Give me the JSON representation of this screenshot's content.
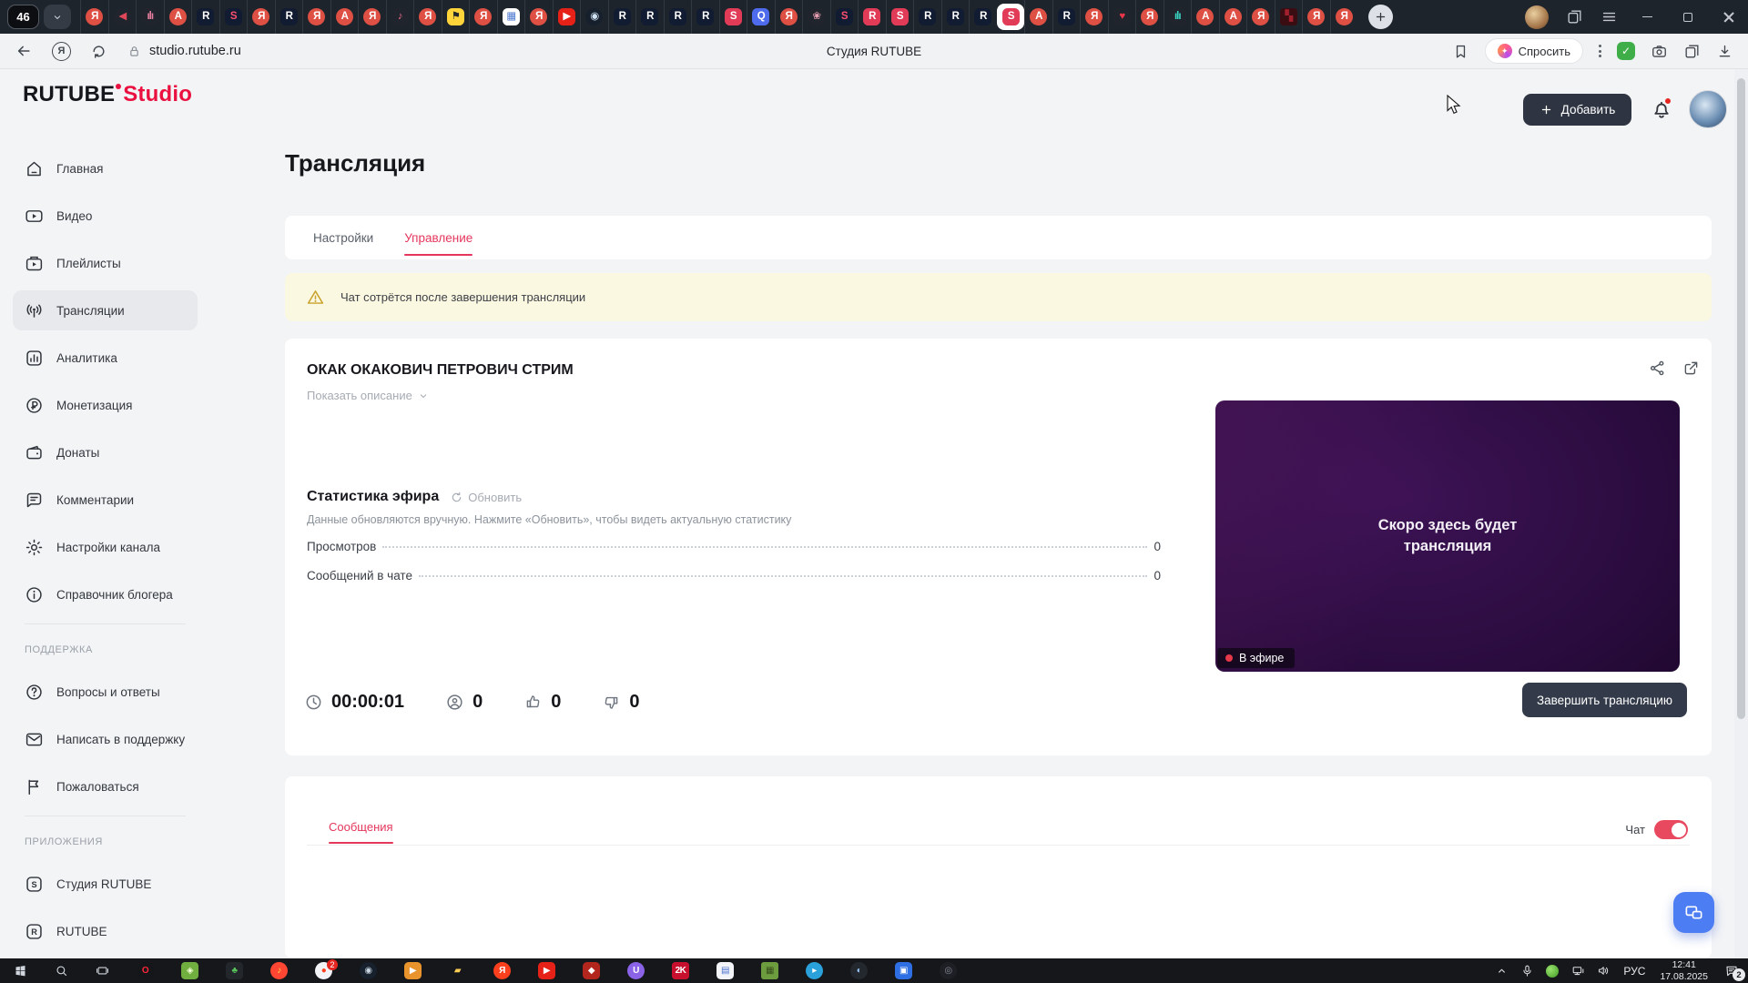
{
  "theme": {
    "accent_red": "#e5365c",
    "dark_button": "#2e3441",
    "warning_bg": "#fbf8e2",
    "live_red": "#e5394a",
    "fab_blue": "#4d7df2",
    "chrome_dark": "#1e242c",
    "taskbar_dark": "#16171a"
  },
  "browser": {
    "tab_count": "46",
    "window_title": "Студия RUTUBE",
    "url": "studio.rutube.ru",
    "ask_label": "Спросить",
    "ask_icon_glyph": "✦",
    "yandex_button_glyph": "Я",
    "new_tab_glyph": "+",
    "tabs": [
      {
        "n": "tab-favicon-yandex",
        "g": "Я",
        "bg": "#df5044",
        "fg": "#ffffff",
        "br": "50%"
      },
      {
        "n": "tab-favicon-sound",
        "g": "◀",
        "bg": "#20242c",
        "fg": "#e0485a",
        "br": "35%"
      },
      {
        "n": "tab-favicon-audio-bars",
        "g": "ılı",
        "bg": "#20242c",
        "fg": "#e87fa0",
        "br": "35%"
      },
      {
        "n": "tab-favicon-alice",
        "g": "A",
        "bg": "#df5044",
        "fg": "#ffffff",
        "br": "50%"
      },
      {
        "n": "tab-favicon-rutube",
        "g": "R",
        "bg": "#111b32",
        "fg": "#ffffff",
        "br": "30%"
      },
      {
        "n": "tab-favicon-studio-navy",
        "g": "S",
        "bg": "#111b32",
        "fg": "#ff4f6e",
        "br": "30%"
      },
      {
        "n": "tab-favicon-yandex",
        "g": "Я",
        "bg": "#df5044",
        "fg": "#ffffff",
        "br": "50%"
      },
      {
        "n": "tab-favicon-rutube",
        "g": "R",
        "bg": "#111b32",
        "fg": "#ffffff",
        "br": "30%"
      },
      {
        "n": "tab-favicon-yandex",
        "g": "Я",
        "bg": "#df5044",
        "fg": "#ffffff",
        "br": "50%"
      },
      {
        "n": "tab-favicon-alice",
        "g": "A",
        "bg": "#df5044",
        "fg": "#ffffff",
        "br": "50%"
      },
      {
        "n": "tab-favicon-yandex",
        "g": "Я",
        "bg": "#df5044",
        "fg": "#ffffff",
        "br": "50%"
      },
      {
        "n": "tab-favicon-music",
        "g": "♪",
        "bg": "#20242c",
        "fg": "#e86a8a",
        "br": "35%"
      },
      {
        "n": "tab-favicon-yandex",
        "g": "Я",
        "bg": "#df5044",
        "fg": "#ffffff",
        "br": "50%"
      },
      {
        "n": "tab-favicon-images",
        "g": "⚑",
        "bg": "#ffd43b",
        "fg": "#23262b",
        "br": "30%"
      },
      {
        "n": "tab-favicon-yandex",
        "g": "Я",
        "bg": "#df5044",
        "fg": "#ffffff",
        "br": "50%"
      },
      {
        "n": "tab-favicon-grid",
        "g": "▦",
        "bg": "#ffffff",
        "fg": "#4a76d0",
        "br": "30%"
      },
      {
        "n": "tab-favicon-yandex",
        "g": "Я",
        "bg": "#df5044",
        "fg": "#ffffff",
        "br": "50%"
      },
      {
        "n": "tab-favicon-youtube",
        "g": "▶",
        "bg": "#e62117",
        "fg": "#ffffff",
        "br": "30%"
      },
      {
        "n": "tab-favicon-steam",
        "g": "◉",
        "bg": "#16202d",
        "fg": "#cfe3f5",
        "br": "50%"
      },
      {
        "n": "tab-favicon-rutube",
        "g": "R",
        "bg": "#111b32",
        "fg": "#ffffff",
        "br": "30%"
      },
      {
        "n": "tab-favicon-rutube",
        "g": "R",
        "bg": "#111b32",
        "fg": "#ffffff",
        "br": "30%"
      },
      {
        "n": "tab-favicon-rutube",
        "g": "R",
        "bg": "#111b32",
        "fg": "#ffffff",
        "br": "30%"
      },
      {
        "n": "tab-favicon-rutube",
        "g": "R",
        "bg": "#111b32",
        "fg": "#ffffff",
        "br": "30%"
      },
      {
        "n": "tab-favicon-studio-red",
        "g": "S",
        "bg": "#e23b57",
        "fg": "#ffffff",
        "br": "30%"
      },
      {
        "n": "tab-favicon-q-app",
        "g": "Q",
        "bg": "#4f6bed",
        "fg": "#ffffff",
        "br": "30%"
      },
      {
        "n": "tab-favicon-yandex",
        "g": "Я",
        "bg": "#df5044",
        "fg": "#ffffff",
        "br": "50%"
      },
      {
        "n": "tab-favicon-brain",
        "g": "❀",
        "bg": "#20242c",
        "fg": "#e8a0b4",
        "br": "50%"
      },
      {
        "n": "tab-favicon-studio-navy",
        "g": "S",
        "bg": "#111b32",
        "fg": "#ff4f6e",
        "br": "30%"
      },
      {
        "n": "tab-favicon-rutube-red",
        "g": "R",
        "bg": "#e23b57",
        "fg": "#ffffff",
        "br": "30%"
      },
      {
        "n": "tab-favicon-studio-red",
        "g": "S",
        "bg": "#e23b57",
        "fg": "#ffffff",
        "br": "30%"
      },
      {
        "n": "tab-favicon-rutube",
        "g": "R",
        "bg": "#111b32",
        "fg": "#ffffff",
        "br": "30%"
      },
      {
        "n": "tab-favicon-rutube",
        "g": "R",
        "bg": "#111b32",
        "fg": "#ffffff",
        "br": "30%"
      },
      {
        "n": "tab-favicon-rutube",
        "g": "R",
        "bg": "#111b32",
        "fg": "#ffffff",
        "br": "30%"
      },
      {
        "n": "tab-favicon-studio-active",
        "g": "S",
        "bg": "#e23b57",
        "fg": "#ffffff",
        "br": "30%",
        "on": true
      },
      {
        "n": "tab-favicon-alice",
        "g": "A",
        "bg": "#df5044",
        "fg": "#ffffff",
        "br": "50%"
      },
      {
        "n": "tab-favicon-rutube",
        "g": "R",
        "bg": "#111b32",
        "fg": "#ffffff",
        "br": "30%"
      },
      {
        "n": "tab-favicon-yandex",
        "g": "Я",
        "bg": "#df5044",
        "fg": "#ffffff",
        "br": "50%"
      },
      {
        "n": "tab-favicon-heart",
        "g": "♥",
        "bg": "#20242c",
        "fg": "#e8374a",
        "br": "35%"
      },
      {
        "n": "tab-favicon-yandex",
        "g": "Я",
        "bg": "#df5044",
        "fg": "#ffffff",
        "br": "50%"
      },
      {
        "n": "tab-favicon-wave",
        "g": "ılı",
        "bg": "#20242c",
        "fg": "#3ad6c5",
        "br": "35%"
      },
      {
        "n": "tab-favicon-alice",
        "g": "A",
        "bg": "#df5044",
        "fg": "#ffffff",
        "br": "50%"
      },
      {
        "n": "tab-favicon-alice",
        "g": "A",
        "bg": "#df5044",
        "fg": "#ffffff",
        "br": "50%"
      },
      {
        "n": "tab-favicon-yandex",
        "g": "Я",
        "bg": "#df5044",
        "fg": "#ffffff",
        "br": "50%"
      },
      {
        "n": "tab-favicon-dark-video",
        "g": "▚",
        "bg": "#3a0d12",
        "fg": "#a3212e",
        "br": "20%"
      },
      {
        "n": "tab-favicon-yandex",
        "g": "Я",
        "bg": "#df5044",
        "fg": "#ffffff",
        "br": "50%"
      },
      {
        "n": "tab-favicon-yandex",
        "g": "Я",
        "bg": "#df5044",
        "fg": "#ffffff",
        "br": "50%"
      }
    ]
  },
  "header": {
    "logo_main": "RUTUBE",
    "logo_suffix": "Studio",
    "add_label": "Добавить"
  },
  "sidebar": {
    "main_items": [
      {
        "n": "sidebar-item-home",
        "icon": "#i-home",
        "label": "Главная"
      },
      {
        "n": "sidebar-item-video",
        "icon": "#i-video",
        "label": "Видео"
      },
      {
        "n": "sidebar-item-playlists",
        "icon": "#i-playlist",
        "label": "Плейлисты"
      },
      {
        "n": "sidebar-item-broadcasts",
        "icon": "#i-broadcast",
        "label": "Трансляции",
        "active": true
      },
      {
        "n": "sidebar-item-analytics",
        "icon": "#i-analytics",
        "label": "Аналитика"
      },
      {
        "n": "sidebar-item-monetization",
        "icon": "#i-money",
        "label": "Монетизация"
      },
      {
        "n": "sidebar-item-donations",
        "icon": "#i-wallet",
        "label": "Донаты"
      },
      {
        "n": "sidebar-item-comments",
        "icon": "#i-comment",
        "label": "Комментарии"
      },
      {
        "n": "sidebar-item-channel-settings",
        "icon": "#i-gear",
        "label": "Настройки канала"
      },
      {
        "n": "sidebar-item-blogger-guide",
        "icon": "#i-info",
        "label": "Справочник блогера"
      }
    ],
    "support_header": "ПОДДЕРЖКА",
    "support_items": [
      {
        "n": "sidebar-item-faq",
        "icon": "#i-question",
        "label": "Вопросы и ответы"
      },
      {
        "n": "sidebar-item-contact-support",
        "icon": "#i-mail",
        "label": "Написать в поддержку"
      },
      {
        "n": "sidebar-item-report",
        "icon": "#i-flag",
        "label": "Пожаловаться"
      }
    ],
    "apps_header": "ПРИЛОЖЕНИЯ",
    "apps_items": [
      {
        "n": "sidebar-item-studio-app",
        "icon": "#i-app-s",
        "label": "Студия RUTUBE"
      },
      {
        "n": "sidebar-item-rutube-app",
        "icon": "#i-app-r",
        "label": "RUTUBE"
      }
    ]
  },
  "page": {
    "title": "Трансляция",
    "tabs": [
      {
        "n": "tab-settings",
        "label": "Настройки"
      },
      {
        "n": "tab-control",
        "label": "Управление",
        "active": true
      }
    ],
    "warning": "Чат сотрётся после завершения трансляции",
    "stream": {
      "title": "ОКАК ОКАКОВИЧ ПЕТРОВИЧ СТРИМ",
      "show_description": "Показать описание",
      "stats_heading": "Статистика эфира",
      "refresh_label": "Обновить",
      "stats_note": "Данные обновляются вручную. Нажмите «Обновить», чтобы видеть актуальную статистику",
      "rows": [
        {
          "n": "stat-row-views",
          "label": "Просмотров",
          "value": "0"
        },
        {
          "n": "stat-row-chat-messages",
          "label": "Сообщений в чате",
          "value": "0"
        }
      ],
      "preview_line1": "Скоро здесь будет",
      "preview_line2": "трансляция",
      "live_badge": "В эфире",
      "duration": "00:00:01",
      "viewers": "0",
      "likes": "0",
      "dislikes": "0",
      "end_button": "Завершить трансляцию"
    },
    "messages": {
      "tab_label": "Сообщения",
      "chat_label": "Чат"
    }
  },
  "taskbar": {
    "apps": [
      {
        "n": "taskbar-app-opera",
        "g": "O",
        "bg": "#14161a",
        "fg": "#ff2638",
        "br": "50%"
      },
      {
        "n": "taskbar-app-antivirus",
        "g": "◈",
        "bg": "#6fae3f",
        "fg": "#f3ffd6",
        "br": "22%"
      },
      {
        "n": "taskbar-app-leaf",
        "g": "♣",
        "bg": "#23262b",
        "fg": "#58c75b",
        "br": "22%"
      },
      {
        "n": "taskbar-app-yandex-music",
        "g": "♪",
        "bg": "#ff4632",
        "fg": "#ffdb4d",
        "br": "50%"
      },
      {
        "n": "taskbar-app-yandex-browser",
        "g": "●",
        "bg": "#f1f3f6",
        "fg": "#fc3f1d",
        "br": "50%",
        "badge": "2"
      },
      {
        "n": "taskbar-app-steam",
        "g": "◉",
        "bg": "#17202d",
        "fg": "#c7d5e0",
        "br": "50%"
      },
      {
        "n": "taskbar-app-potplayer",
        "g": "▶",
        "bg": "#e8932c",
        "fg": "#ffffff",
        "br": "25%"
      },
      {
        "n": "taskbar-app-explorer",
        "g": "▰",
        "bg": "#16171a",
        "fg": "#ffce54",
        "br": "0"
      },
      {
        "n": "taskbar-app-yandex",
        "g": "Я",
        "bg": "#fc3f1d",
        "fg": "#ffffff",
        "br": "50%"
      },
      {
        "n": "taskbar-app-red-play",
        "g": "▶",
        "bg": "#e62117",
        "fg": "#ffffff",
        "br": "25%"
      },
      {
        "n": "taskbar-app-shield",
        "g": "◆",
        "bg": "#b3261e",
        "fg": "#ffffff",
        "br": "25%"
      },
      {
        "n": "taskbar-app-ubisoft",
        "g": "U",
        "bg": "#8a63e8",
        "fg": "#ffffff",
        "br": "50%"
      },
      {
        "n": "taskbar-app-2k",
        "g": "2K",
        "bg": "#c8102e",
        "fg": "#ffffff",
        "br": "20%"
      },
      {
        "n": "taskbar-app-library",
        "g": "▤",
        "bg": "#f2f4f7",
        "fg": "#4a6fd0",
        "br": "25%"
      },
      {
        "n": "taskbar-app-minecraft",
        "g": "▦",
        "bg": "#6d9c3f",
        "fg": "#374f1e",
        "br": "15%"
      },
      {
        "n": "taskbar-app-telegram",
        "g": "▸",
        "bg": "#2aa1da",
        "fg": "#ffffff",
        "br": "50%"
      },
      {
        "n": "taskbar-app-globe",
        "g": "◐",
        "bg": "#23272e",
        "fg": "#9ecbff",
        "br": "50%"
      },
      {
        "n": "taskbar-app-blue-folder",
        "g": "▣",
        "bg": "#2f6fe4",
        "fg": "#ffffff",
        "br": "25%"
      },
      {
        "n": "taskbar-app-disc",
        "g": "◎",
        "bg": "#1d1f24",
        "fg": "#8a8f98",
        "br": "50%"
      }
    ],
    "tray": {
      "lang": "РУС",
      "time": "12:41",
      "date": "17.08.2025",
      "notif_badge": "2"
    }
  }
}
